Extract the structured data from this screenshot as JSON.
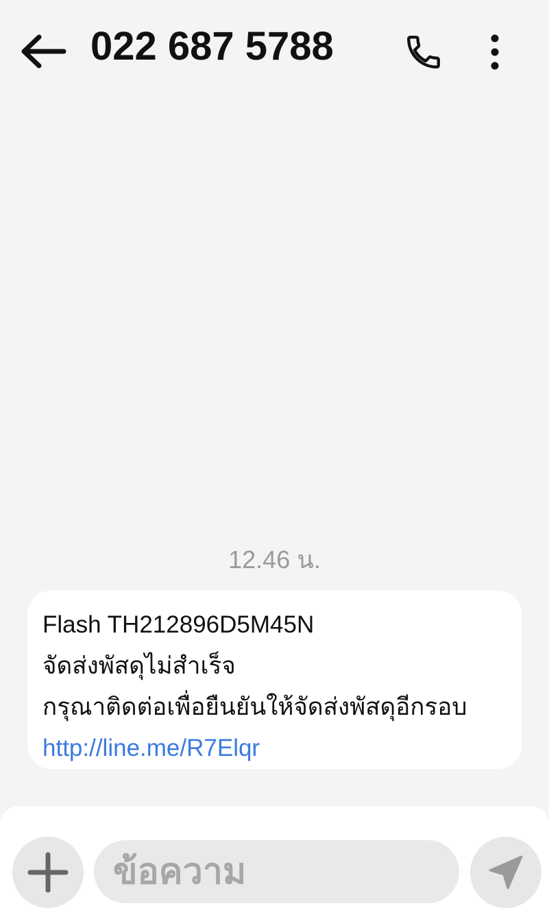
{
  "header": {
    "title": "022 687 5788",
    "back_icon": "arrow-left-icon",
    "call_icon": "phone-icon",
    "more_icon": "more-vertical-icon"
  },
  "conversation": {
    "timestamp": "12.46 น.",
    "messages": [
      {
        "lines": [
          "Flash TH212896D5M45N",
          "จัดส่งพัสดุไม่สำเร็จ",
          "กรุณาติดต่อเพื่อยืนยันให้จัดส่งพัสดุอีกรอบ"
        ],
        "link": "http://line.me/R7Elqr"
      }
    ]
  },
  "composer": {
    "placeholder": "ข้อความ",
    "add_icon": "plus-icon",
    "send_icon": "send-icon"
  },
  "colors": {
    "background": "#f4f4f4",
    "bubble": "#ffffff",
    "link": "#3a7be0",
    "timestamp": "#9a9a9a",
    "button_bg": "#e7e7e7"
  }
}
